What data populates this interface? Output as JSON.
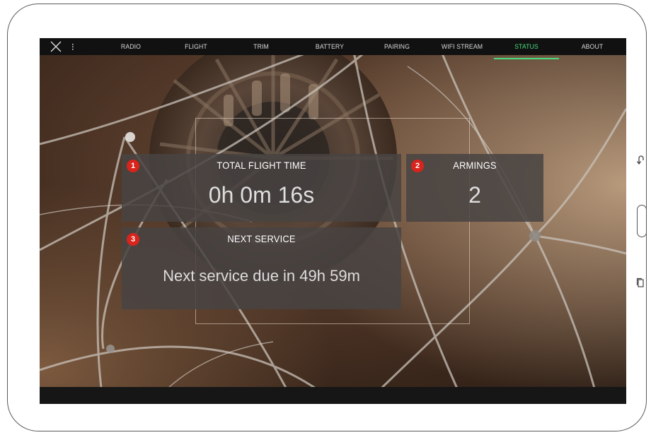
{
  "nav": {
    "tabs": [
      {
        "label": "RADIO",
        "active": false
      },
      {
        "label": "FLIGHT",
        "active": false
      },
      {
        "label": "TRIM",
        "active": false
      },
      {
        "label": "BATTERY",
        "active": false
      },
      {
        "label": "PAIRING",
        "active": false
      },
      {
        "label": "WIFI STREAM",
        "active": false
      },
      {
        "label": "STATUS",
        "active": true
      },
      {
        "label": "ABOUT",
        "active": false
      }
    ],
    "close_icon": "close-x-icon",
    "more_icon": "vertical-dots-icon"
  },
  "status": {
    "total_flight_time": {
      "badge": "1",
      "title": "TOTAL FLIGHT TIME",
      "value": "0h 0m 16s"
    },
    "armings": {
      "badge": "2",
      "title": "ARMINGS",
      "value": "2"
    },
    "next_service": {
      "badge": "3",
      "title": "NEXT SERVICE",
      "value": "Next service due in 49h 59m"
    }
  },
  "device": {
    "back_icon": "back-icon",
    "home_icon": "home-button-icon",
    "recents_icon": "recents-icon"
  },
  "colors": {
    "accent": "#4ade80",
    "badge": "#d9241c",
    "panel": "#484442",
    "navbar": "#111111"
  }
}
